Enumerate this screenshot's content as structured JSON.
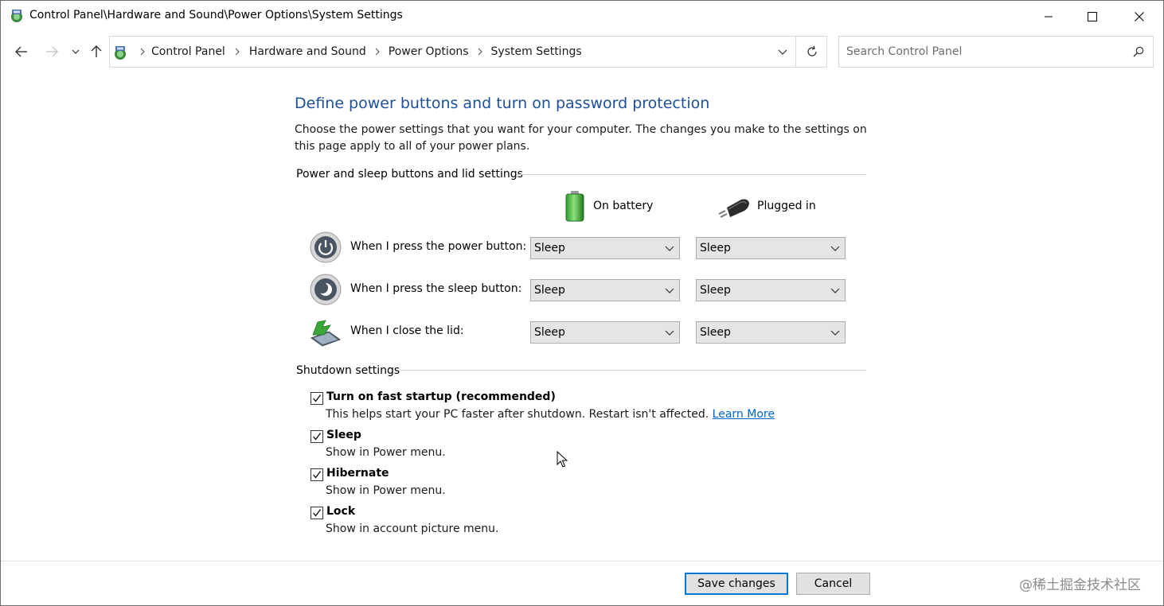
{
  "window": {
    "title": "Control Panel\\Hardware and Sound\\Power Options\\System Settings"
  },
  "address_bar": {
    "breadcrumbs": [
      "Control Panel",
      "Hardware and Sound",
      "Power Options",
      "System Settings"
    ]
  },
  "search": {
    "placeholder": "Search Control Panel"
  },
  "page": {
    "title": "Define power buttons and turn on password protection",
    "description": "Choose the power settings that you want for your computer. The changes you make to the settings on this page apply to all of your power plans."
  },
  "power_section": {
    "header": "Power and sleep buttons and lid settings",
    "columns": {
      "on_battery": "On battery",
      "plugged_in": "Plugged in"
    },
    "rows": [
      {
        "icon": "power-button-icon",
        "label": "When I press the power button:",
        "on_battery": "Sleep",
        "plugged_in": "Sleep"
      },
      {
        "icon": "sleep-button-icon",
        "label": "When I press the sleep button:",
        "on_battery": "Sleep",
        "plugged_in": "Sleep"
      },
      {
        "icon": "laptop-lid-icon",
        "label": "When I close the lid:",
        "on_battery": "Sleep",
        "plugged_in": "Sleep"
      }
    ]
  },
  "shutdown_section": {
    "header": "Shutdown settings",
    "items": [
      {
        "title": "Turn on fast startup (recommended)",
        "checked": true,
        "description": "This helps start your PC faster after shutdown. Restart isn't affected. ",
        "link": "Learn More"
      },
      {
        "title": "Sleep",
        "checked": true,
        "description": "Show in Power menu."
      },
      {
        "title": "Hibernate",
        "checked": true,
        "description": "Show in Power menu."
      },
      {
        "title": "Lock",
        "checked": true,
        "description": "Show in account picture menu."
      }
    ]
  },
  "buttons": {
    "save": "Save changes",
    "cancel": "Cancel"
  },
  "watermark": "@稀土掘金技术社区",
  "colors": {
    "title_blue": "#1e4f9c",
    "link_blue": "#0066cc",
    "focus_border": "#0078d7"
  }
}
